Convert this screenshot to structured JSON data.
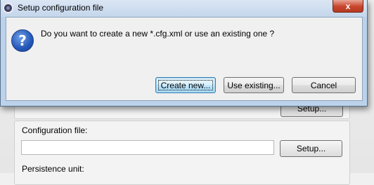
{
  "background": {
    "partial_button_label": "Setup...",
    "config_file_label": "Configuration file:",
    "config_file_value": "",
    "setup_button_label": "Setup...",
    "persistence_unit_label": "Persistence unit:"
  },
  "dialog": {
    "title": "Setup configuration file",
    "close_symbol": "x",
    "question_symbol": "?",
    "message": "Do you want to create a new *.cfg.xml or use an existing one ?",
    "buttons": {
      "create_new": "Create new...",
      "use_existing": "Use existing...",
      "cancel": "Cancel"
    }
  },
  "colors": {
    "titlebar": "#c4d6ec",
    "close_button": "#c7452c",
    "default_button": "#a7d9f5",
    "question_icon": "#2457b8"
  },
  "icons": {
    "app": "eclipse-icon",
    "question": "question-icon",
    "close": "close-icon"
  }
}
